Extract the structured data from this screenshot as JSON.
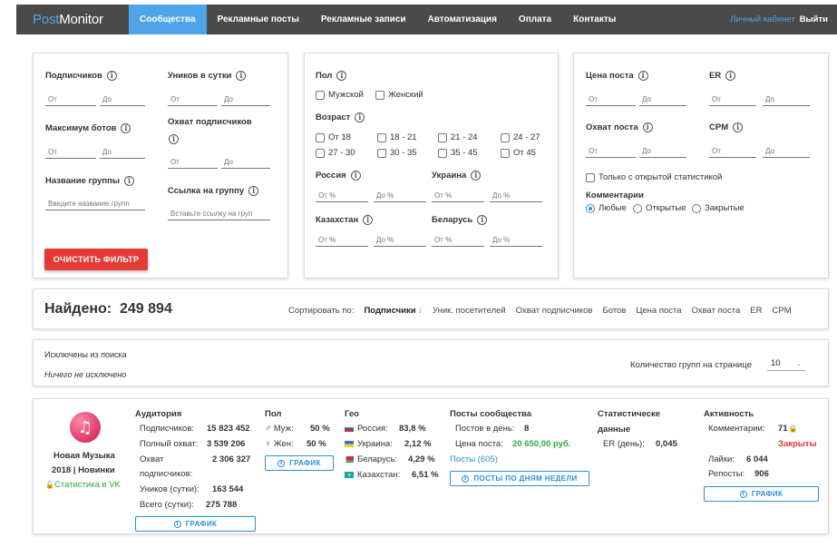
{
  "nav": {
    "logo_a": "Post",
    "logo_b": "Monitor",
    "items": [
      "Сообщества",
      "Рекламные посты",
      "Рекламные записи",
      "Автоматизация",
      "Оплата",
      "Контакты"
    ],
    "cabinet": "Личный кабинет",
    "logout": "Выйти"
  },
  "filters": {
    "subscribers": {
      "label": "Подписчиков",
      "from": "От",
      "to": "До"
    },
    "uniques": {
      "label": "Уников в сутки",
      "from": "От",
      "to": "До"
    },
    "bots": {
      "label": "Максимум ботов",
      "from": "От",
      "to": "До"
    },
    "reach": {
      "label": "Охват подписчиков",
      "from": "От",
      "to": "До"
    },
    "group_name": {
      "label": "Название группы",
      "placeholder": "Введите название групп"
    },
    "group_link": {
      "label": "Ссылка на группу",
      "placeholder": "Вставьте ссылку на груп"
    },
    "clear_button": "ОЧИСТИТЬ ФИЛЬТР",
    "gender": {
      "label": "Пол",
      "male": "Мужской",
      "female": "Женский"
    },
    "age": {
      "label": "Возраст",
      "options": [
        "От 18",
        "18 - 21",
        "21 - 24",
        "24 - 27",
        "27 - 30",
        "30 - 35",
        "35 - 45",
        "От 45"
      ]
    },
    "russia": {
      "label": "Россия",
      "from": "От %",
      "to": "До %"
    },
    "ukraine": {
      "label": "Украина",
      "from": "От %",
      "to": "До %"
    },
    "kazakhstan": {
      "label": "Казахстан",
      "from": "От %",
      "to": "До %"
    },
    "belarus": {
      "label": "Беларусь",
      "from": "От %",
      "to": "До %"
    },
    "post_price": {
      "label": "Цена поста",
      "from": "От",
      "to": "До"
    },
    "er": {
      "label": "ER",
      "from": "От",
      "to": "До"
    },
    "post_reach": {
      "label": "Охват поста",
      "from": "От",
      "to": "До"
    },
    "cpm": {
      "label": "CPM",
      "from": "От",
      "to": "До"
    },
    "open_stats": "Только с открытой статистикой",
    "comments": {
      "label": "Комментарии",
      "options": [
        "Любые",
        "Открытые",
        "Закрытые"
      ],
      "selected": "Любые"
    }
  },
  "results": {
    "found_label": "Найдено:",
    "found_count": "249 894",
    "sort_label": "Сортировать по:",
    "sort_current": "Подписчики",
    "sort_arrow": "↓",
    "sort_options": [
      "Уник. посетителей",
      "Охват подписчиков",
      "Ботов",
      "Цена поста",
      "Охват поста",
      "ER",
      "CPM"
    ]
  },
  "excluded": {
    "title": "Исключены из поиска",
    "empty": "Ничего не исключено",
    "per_page_label": "Количество групп на странице",
    "per_page_value": "10"
  },
  "group": {
    "name_line1": "Новая Музыка",
    "name_line2": "2018 | Новинки",
    "stats_link": "Статистика в VK",
    "audience": {
      "title": "Аудитория",
      "subscribers_label": "Подписчиков:",
      "subscribers_value": "15 823 452",
      "full_reach_label": "Полный охват:",
      "full_reach_value": "3 539 206",
      "reach_label_1": "Охват",
      "reach_label_2": "подписчиков:",
      "reach_value": "2 306 327",
      "uniques_label": "Уников (сутки):",
      "uniques_value": "163 544",
      "total_label": "Всего (сутки):",
      "total_value": "275 788",
      "chart_button": "ГРАФИК"
    },
    "gender": {
      "title": "Пол",
      "male_label": "Муж:",
      "male_value": "50 %",
      "female_label": "Жен:",
      "female_value": "50 %",
      "chart_button": "ГРАФИК"
    },
    "geo": {
      "title": "Гео",
      "items": [
        {
          "label": "Россия:",
          "value": "83,8 %"
        },
        {
          "label": "Украина:",
          "value": "2,12 %"
        },
        {
          "label": "Беларусь:",
          "value": "4,29 %"
        },
        {
          "label": "Казахстан:",
          "value": "6,51 %"
        }
      ]
    },
    "posts": {
      "title": "Посты сообщества",
      "per_day_label": "Постов в день:",
      "per_day_value": "8",
      "price_label": "Цена поста:",
      "price_value": "20 650,00 руб.",
      "posts_link": "Посты (605)",
      "weekday_button": "ПОСТЫ ПО ДНЯМ НЕДЕЛИ"
    },
    "stats": {
      "title_1": "Статистическе",
      "title_2": "данные",
      "er_label": "ER (день):",
      "er_value": "0,045"
    },
    "activity": {
      "title": "Активность",
      "comments_label": "Комментарии:",
      "comments_value": "71",
      "closed": "Закрыты",
      "likes_label": "Лайки:",
      "likes_value": "6 044",
      "reposts_label": "Репосты:",
      "reposts_value": "906",
      "chart_button": "ГРАФИК"
    }
  },
  "colors": {
    "accent": "#4fa3e8",
    "nav_bg": "#4a4a4a",
    "danger": "#e53935",
    "price_green": "#2eaa3f",
    "link_blue": "#2d8ed8"
  }
}
